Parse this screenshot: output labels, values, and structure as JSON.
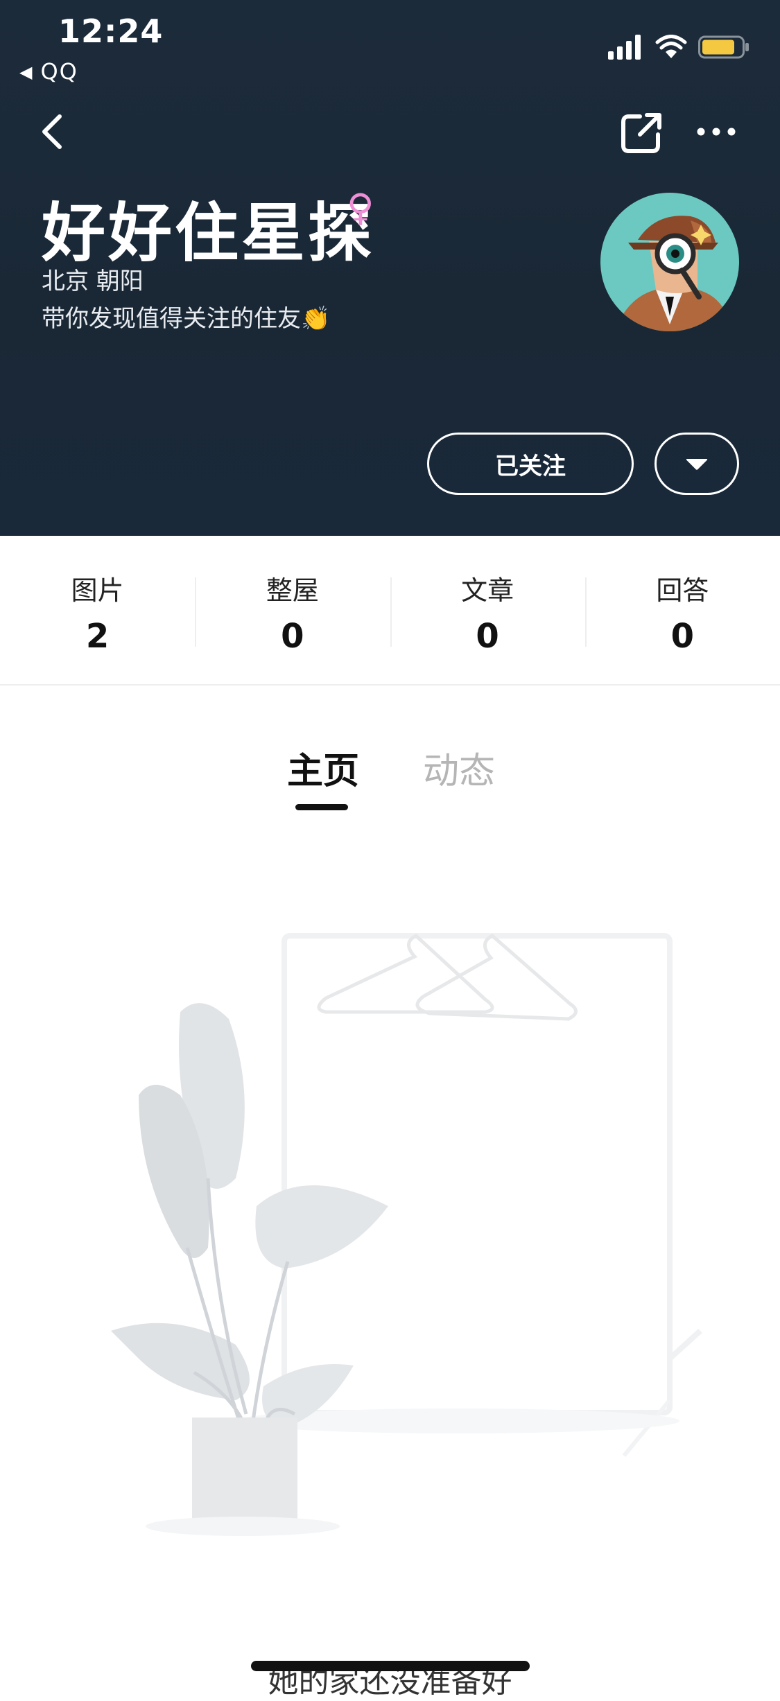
{
  "status_bar": {
    "time": "12:24",
    "back_app": "QQ",
    "icons": [
      "signal-icon",
      "wifi-icon",
      "battery-icon"
    ],
    "battery_color": "#f5c842"
  },
  "nav": {
    "icons": [
      "back-chevron-icon",
      "share-icon",
      "more-icon"
    ]
  },
  "profile": {
    "name": "好好住星探",
    "gender_symbol": "♀",
    "gender_color": "#ee8fd6",
    "location": "北京 朝阳",
    "bio": "带你发现值得关注的住友👏",
    "avatar_icon": "detective-avatar"
  },
  "actions": {
    "follow_label": "已关注",
    "dropdown_icon": "caret-down-icon"
  },
  "stats": [
    {
      "label": "图片",
      "value": "2"
    },
    {
      "label": "整屋",
      "value": "0"
    },
    {
      "label": "文章",
      "value": "0"
    },
    {
      "label": "回答",
      "value": "0"
    }
  ],
  "tabs": [
    {
      "label": "主页",
      "active": true
    },
    {
      "label": "动态",
      "active": false
    }
  ],
  "empty_state": {
    "illustration": "plant-and-clothes-rack",
    "message": "她的家还没准备好"
  },
  "colors": {
    "header_bg": "#1c2b3a",
    "accent_text": "#111111",
    "inactive_tab": "#b5b5b5"
  }
}
